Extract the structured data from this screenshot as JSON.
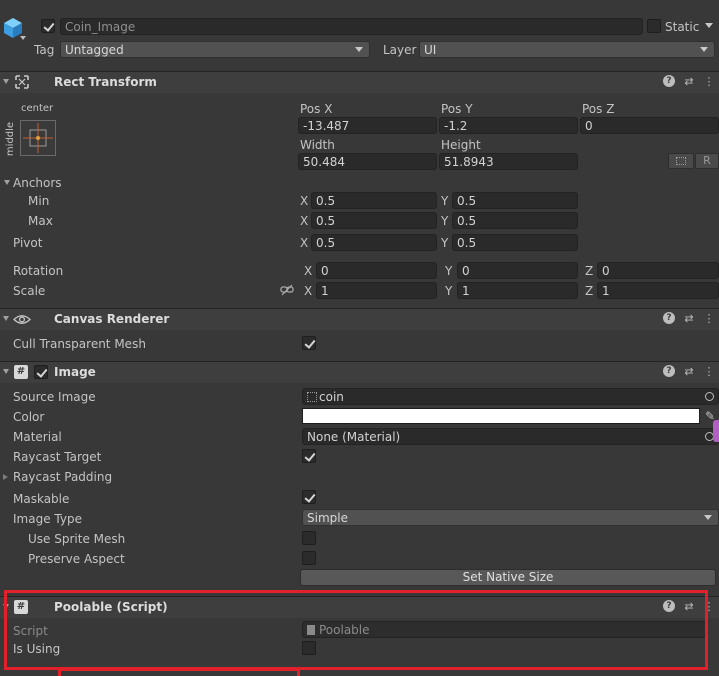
{
  "gameobject": {
    "name": "Coin_Image",
    "static_label": "Static",
    "tag_label": "Tag",
    "tag_value": "Untagged",
    "layer_label": "Layer",
    "layer_value": "UI"
  },
  "rect_transform": {
    "title": "Rect Transform",
    "anchor_preset_h": "center",
    "anchor_preset_v": "middle",
    "pos_x_label": "Pos X",
    "pos_y_label": "Pos Y",
    "pos_z_label": "Pos Z",
    "pos_x": "-13.487",
    "pos_y": "-1.2",
    "pos_z": "0",
    "width_label": "Width",
    "height_label": "Height",
    "width": "50.484",
    "height": "51.8943",
    "r_button": "R",
    "anchors_label": "Anchors",
    "min_label": "Min",
    "max_label": "Max",
    "pivot_label": "Pivot",
    "x": "X",
    "y": "Y",
    "z": "Z",
    "min_x": "0.5",
    "min_y": "0.5",
    "max_x": "0.5",
    "max_y": "0.5",
    "pivot_x": "0.5",
    "pivot_y": "0.5",
    "rotation_label": "Rotation",
    "rot_x": "0",
    "rot_y": "0",
    "rot_z": "0",
    "scale_label": "Scale",
    "scale_x": "1",
    "scale_y": "1",
    "scale_z": "1"
  },
  "canvas_renderer": {
    "title": "Canvas Renderer",
    "cull_label": "Cull Transparent Mesh"
  },
  "image": {
    "title": "Image",
    "source_image_label": "Source Image",
    "source_image_value": "coin",
    "color_label": "Color",
    "material_label": "Material",
    "material_value": "None (Material)",
    "raycast_target_label": "Raycast Target",
    "raycast_padding_label": "Raycast Padding",
    "maskable_label": "Maskable",
    "image_type_label": "Image Type",
    "image_type_value": "Simple",
    "use_sprite_mesh_label": "Use Sprite Mesh",
    "preserve_aspect_label": "Preserve Aspect",
    "set_native_size_label": "Set Native Size"
  },
  "poolable": {
    "title": "Poolable (Script)",
    "script_label": "Script",
    "script_value": "Poolable",
    "is_using_label": "Is Using"
  },
  "colors": {
    "highlight_border": "#e0202a",
    "panel_bg": "#383838",
    "header_bg": "#3e3e3e",
    "field_bg": "#2a2a2a"
  }
}
